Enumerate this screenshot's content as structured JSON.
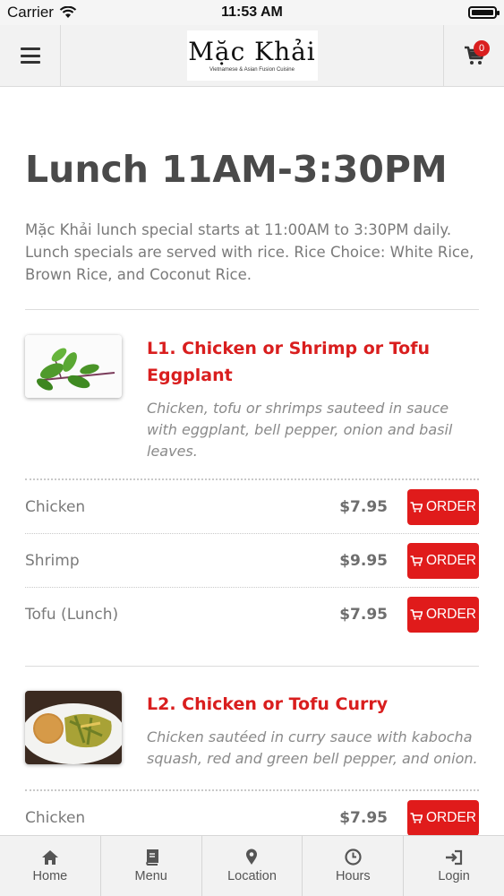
{
  "status_bar": {
    "carrier": "Carrier",
    "time": "11:53 AM"
  },
  "header": {
    "logo_name": "Mặc Khải",
    "logo_tagline": "Vietnamese & Asian Fusion Cuisine",
    "cart_count": "0"
  },
  "page": {
    "title": "Lunch 11AM-3:30PM",
    "intro": "Mặc Khải lunch special starts at 11:00AM to 3:30PM daily. Lunch specials are served with rice. Rice Choice: White Rice, Brown Rice, and Coconut Rice."
  },
  "items": [
    {
      "title": "L1. Chicken or Shrimp or Tofu Eggplant",
      "description": "Chicken, tofu or shrimps sauteed in sauce with eggplant, bell pepper, onion and basil leaves.",
      "options": [
        {
          "name": "Chicken",
          "price": "$7.95",
          "order_label": "ORDER"
        },
        {
          "name": "Shrimp",
          "price": "$9.95",
          "order_label": "ORDER"
        },
        {
          "name": "Tofu (Lunch)",
          "price": "$7.95",
          "order_label": "ORDER"
        }
      ]
    },
    {
      "title": "L2. Chicken or Tofu Curry",
      "description": "Chicken sautéed in curry sauce with kabocha squash, red and green bell pepper, and onion.",
      "options": [
        {
          "name": "Chicken",
          "price": "$7.95",
          "order_label": "ORDER"
        }
      ]
    }
  ],
  "tabs": [
    {
      "label": "Home",
      "icon": "home-icon"
    },
    {
      "label": "Menu",
      "icon": "book-icon"
    },
    {
      "label": "Location",
      "icon": "map-pin-icon"
    },
    {
      "label": "Hours",
      "icon": "clock-icon"
    },
    {
      "label": "Login",
      "icon": "login-icon"
    }
  ],
  "colors": {
    "accent": "#e01b1b",
    "title_red": "#d91e1e",
    "header_bg": "#f2f2f2"
  }
}
